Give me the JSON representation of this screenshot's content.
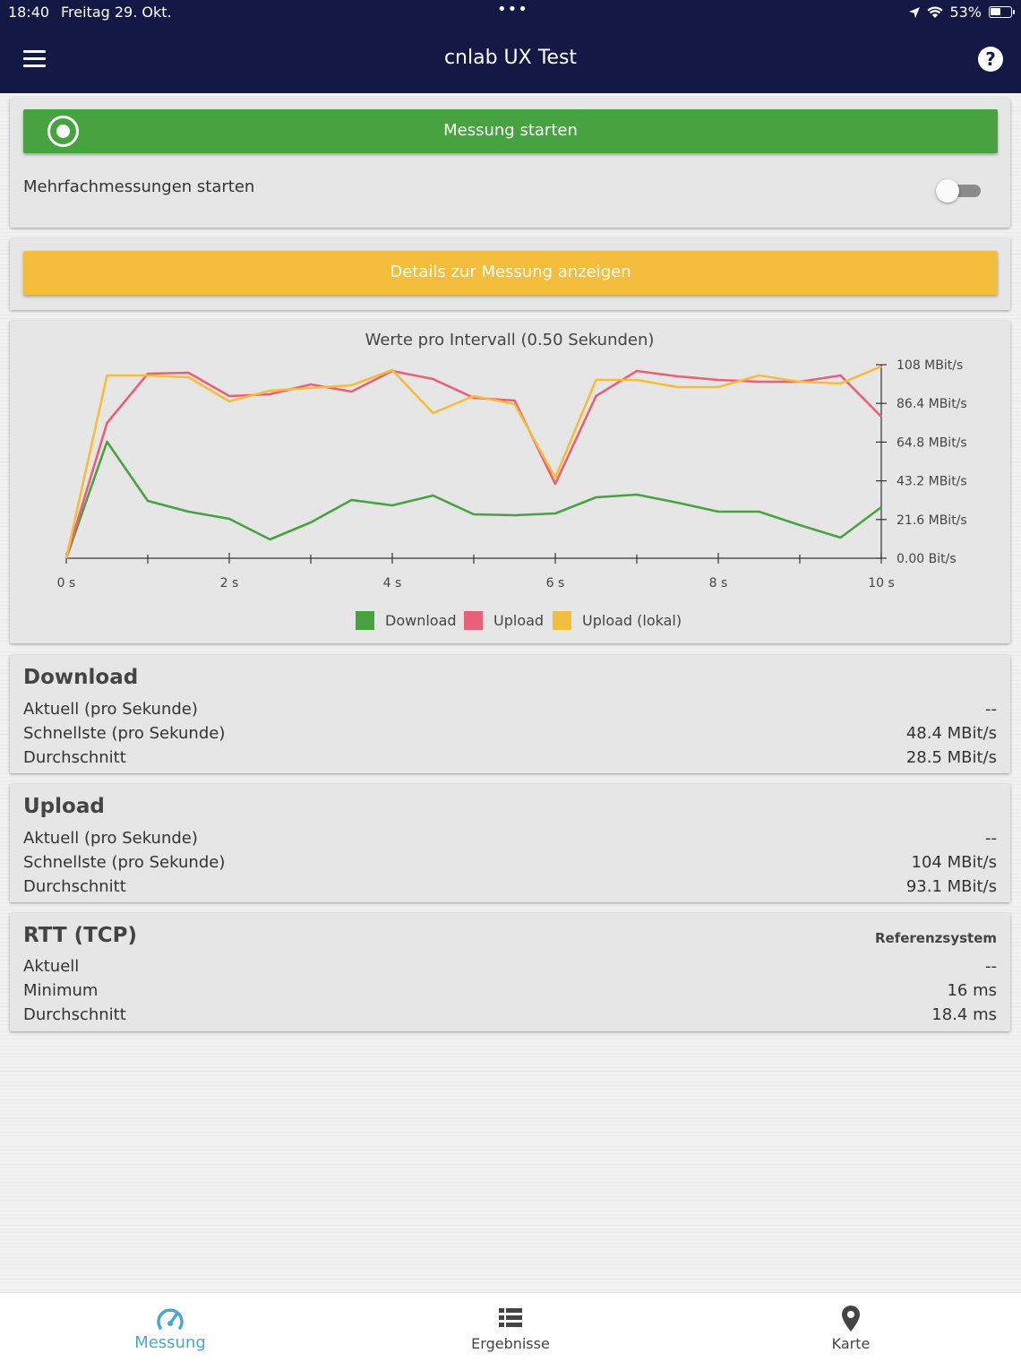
{
  "status_bar": {
    "time": "18:40",
    "date": "Freitag 29. Okt.",
    "dots": "•••",
    "battery_percent": "53%",
    "battery_level": 0.53
  },
  "header": {
    "title": "cnlab UX Test",
    "menu_icon": "hamburger-menu-icon",
    "help_icon": "question-circle-icon"
  },
  "measure_card": {
    "start_label": "Messung starten",
    "multi_label": "Mehrfachmessungen starten",
    "multi_enabled": false
  },
  "details_button": {
    "label": "Details zur Messung anzeigen"
  },
  "chart_data": {
    "type": "line",
    "title": "Werte pro Intervall (0.50 Sekunden)",
    "x": [
      0,
      0.5,
      1,
      1.5,
      2,
      2.5,
      3,
      3.5,
      4,
      4.5,
      5,
      5.5,
      6,
      6.5,
      7,
      7.5,
      8,
      8.5,
      9,
      9.5,
      10
    ],
    "xlim": [
      0,
      10
    ],
    "x_ticks": [
      0,
      2,
      4,
      6,
      8,
      10
    ],
    "x_tick_labels": [
      "0 s",
      "2 s",
      "4 s",
      "6 s",
      "8 s",
      "10 s"
    ],
    "ylim": [
      0,
      108
    ],
    "y_ticks": [
      0,
      21.6,
      43.2,
      64.8,
      86.4,
      108
    ],
    "y_tick_labels": [
      "0.00 Bit/s",
      "21.6 MBit/s",
      "43.2 MBit/s",
      "64.8 MBit/s",
      "86.4 MBit/s",
      "108 MBit/s"
    ],
    "y_axis_side": "right",
    "grid": false,
    "legend_position": "bottom",
    "series": [
      {
        "name": "Download",
        "color": "#47a33f",
        "values": [
          0,
          65,
          32,
          26,
          22,
          10.5,
          20,
          32.5,
          29.5,
          35,
          24.5,
          24,
          25,
          34,
          35.5,
          31,
          26,
          26,
          18.5,
          11.5,
          28.5
        ]
      },
      {
        "name": "Upload",
        "color": "#eb6079",
        "values": [
          0,
          75.5,
          103,
          103.5,
          90.5,
          91.5,
          97,
          93,
          104.5,
          100,
          89.5,
          88,
          41.5,
          90.5,
          104.5,
          101.5,
          99.5,
          98.5,
          98.5,
          102,
          79
        ]
      },
      {
        "name": "Upload (lokal)",
        "color": "#f5bd3c",
        "values": [
          0,
          102,
          102,
          101,
          87.5,
          93.5,
          95,
          96.5,
          105,
          81,
          90.5,
          86,
          45,
          99.5,
          99.5,
          95.5,
          95.5,
          102,
          98.5,
          97.5,
          107
        ]
      }
    ]
  },
  "download": {
    "title": "Download",
    "rows": [
      {
        "label": "Aktuell (pro Sekunde)",
        "value": "--"
      },
      {
        "label": "Schnellste (pro Sekunde)",
        "value": "48.4 MBit/s"
      },
      {
        "label": "Durchschnitt",
        "value": "28.5 MBit/s"
      }
    ]
  },
  "upload": {
    "title": "Upload",
    "rows": [
      {
        "label": "Aktuell (pro Sekunde)",
        "value": "--"
      },
      {
        "label": "Schnellste (pro Sekunde)",
        "value": "104 MBit/s"
      },
      {
        "label": "Durchschnitt",
        "value": "93.1 MBit/s"
      }
    ]
  },
  "rtt": {
    "title": "RTT (TCP)",
    "reference": "Referenzsystem",
    "rows": [
      {
        "label": "Aktuell",
        "value": "--"
      },
      {
        "label": "Minimum",
        "value": "16 ms"
      },
      {
        "label": "Durchschnitt",
        "value": "18.4 ms"
      }
    ]
  },
  "tabs": [
    {
      "label": "Messung",
      "icon": "speedometer-icon",
      "active": true,
      "color": "#4aa8d0"
    },
    {
      "label": "Ergebnisse",
      "icon": "list-icon",
      "active": false
    },
    {
      "label": "Karte",
      "icon": "map-pin-icon",
      "active": false
    }
  ]
}
